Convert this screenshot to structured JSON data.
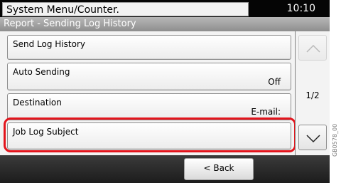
{
  "header": {
    "title": "System Menu/Counter.",
    "time": "10:10"
  },
  "subheader": {
    "title": "Report - Sending Log History"
  },
  "list": {
    "items": [
      {
        "label": "Send Log History",
        "value": ""
      },
      {
        "label": "Auto Sending",
        "value": "Off"
      },
      {
        "label": "Destination",
        "value": "E-mail:"
      },
      {
        "label": "Job Log Subject",
        "value": ""
      }
    ]
  },
  "scroll": {
    "page": "1/2",
    "up_icon": "chevron-up-icon",
    "down_icon": "chevron-down-icon"
  },
  "footer": {
    "back_label": "< Back"
  },
  "figure_code": "GB0578_00",
  "colors": {
    "highlight": "#e3141c",
    "top_bar": "#050505"
  }
}
